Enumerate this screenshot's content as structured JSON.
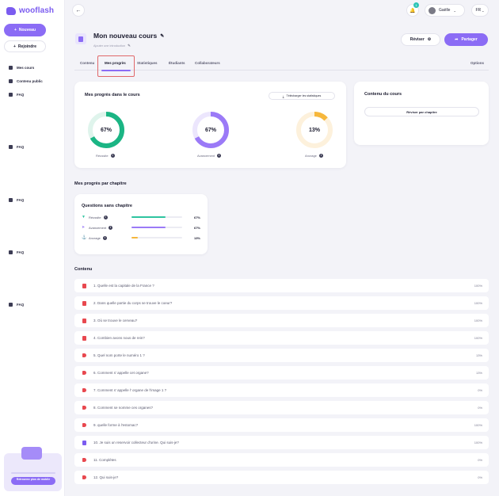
{
  "app": {
    "name": "wooflash"
  },
  "sidebar": {
    "new_label": "Nouveau",
    "join_label": "Rejoindre",
    "items": [
      {
        "label": "Mes cours"
      },
      {
        "label": "Contenu public"
      },
      {
        "label": "FAQ"
      },
      {
        "label": "FAQ"
      },
      {
        "label": "FAQ"
      },
      {
        "label": "FAQ"
      },
      {
        "label": "FAQ"
      }
    ],
    "mobile_cta": "Retrouvez plus de mobile"
  },
  "topbar": {
    "notification_count": "1",
    "user_name": "Gaëlle",
    "language": "FR"
  },
  "course": {
    "title": "Mon nouveau cours",
    "subtitle": "Ajouter une introduction",
    "review_label": "Réviser",
    "share_label": "Partager"
  },
  "tabs": [
    {
      "label": "Contenu"
    },
    {
      "label": "Mes progrès"
    },
    {
      "label": "Statistiques"
    },
    {
      "label": "Étudiants"
    },
    {
      "label": "Collaborateurs"
    }
  ],
  "options_label": "Options",
  "progress": {
    "title": "Mes progrès dans le cours",
    "download_label": "Télécharger les statistiques",
    "metrics": [
      {
        "label": "Réussite",
        "value": 67,
        "display": "67%",
        "color": "#1bb584",
        "track": "#dff4ec"
      },
      {
        "label": "Avancement",
        "value": 67,
        "display": "67%",
        "color": "#9b7af7",
        "track": "#ece6fd"
      },
      {
        "label": "Ancrage",
        "value": 13,
        "display": "13%",
        "color": "#f6b73c",
        "track": "#fdf1dc"
      }
    ]
  },
  "course_content": {
    "title": "Contenu du cours",
    "review_by_chapter": "Réviser par chapitre"
  },
  "chapters": {
    "title": "Mes progrès par chapitre",
    "card_title": "Questions sans chapitre",
    "rows": [
      {
        "label": "Réussite",
        "value": 67,
        "display": "67%",
        "color": "#2ec4a0"
      },
      {
        "label": "Avancement",
        "value": 67,
        "display": "67%",
        "color": "#9b7af7"
      },
      {
        "label": "Ancrage",
        "value": 13,
        "display": "13%",
        "color": "#f6b73c"
      }
    ]
  },
  "content": {
    "title": "Contenu",
    "questions": [
      {
        "text": "1.  Quelle est la capitale de la France ?",
        "value": "100%",
        "icon": "flashcard-icon",
        "color": "#e8484f"
      },
      {
        "text": "2.  Dans quelle partie du corps se trouve le coeur?",
        "value": "100%",
        "icon": "flashcard-icon",
        "color": "#e8484f"
      },
      {
        "text": "3.  Où se trouve le cerveau?",
        "value": "100%",
        "icon": "flashcard-icon",
        "color": "#e8484f"
      },
      {
        "text": "4.  Combien avons nous de rein?",
        "value": "100%",
        "icon": "flashcard-icon",
        "color": "#e8484f"
      },
      {
        "text": "5.  Quel nom porte le numéro 1 ?",
        "value": "13%",
        "icon": "tag-icon",
        "color": "#e8484f"
      },
      {
        "text": "6.  Comment s' appelle cet organe?",
        "value": "13%",
        "icon": "tag-icon",
        "color": "#e8484f"
      },
      {
        "text": "7.  Comment s' appelle l' organe de l'image 1 ?",
        "value": "0%",
        "icon": "tag-icon",
        "color": "#e8484f"
      },
      {
        "text": "8.  Comment se nomme ces organes?",
        "value": "0%",
        "icon": "tag-icon",
        "color": "#e8484f"
      },
      {
        "text": "9.  quelle forme à l'estomac?",
        "value": "100%",
        "icon": "tag-icon",
        "color": "#e8484f"
      },
      {
        "text": "10.  Je suis un reservoir collecteur d'urine. Qui suis-je?",
        "value": "100%",
        "icon": "copy-icon",
        "color": "#7b5cf0"
      },
      {
        "text": "11.  Complétes",
        "value": "0%",
        "icon": "tag-icon",
        "color": "#e8484f"
      },
      {
        "text": "12.  Qui suis-je?",
        "value": "0%",
        "icon": "tag-icon",
        "color": "#e8484f"
      }
    ]
  }
}
